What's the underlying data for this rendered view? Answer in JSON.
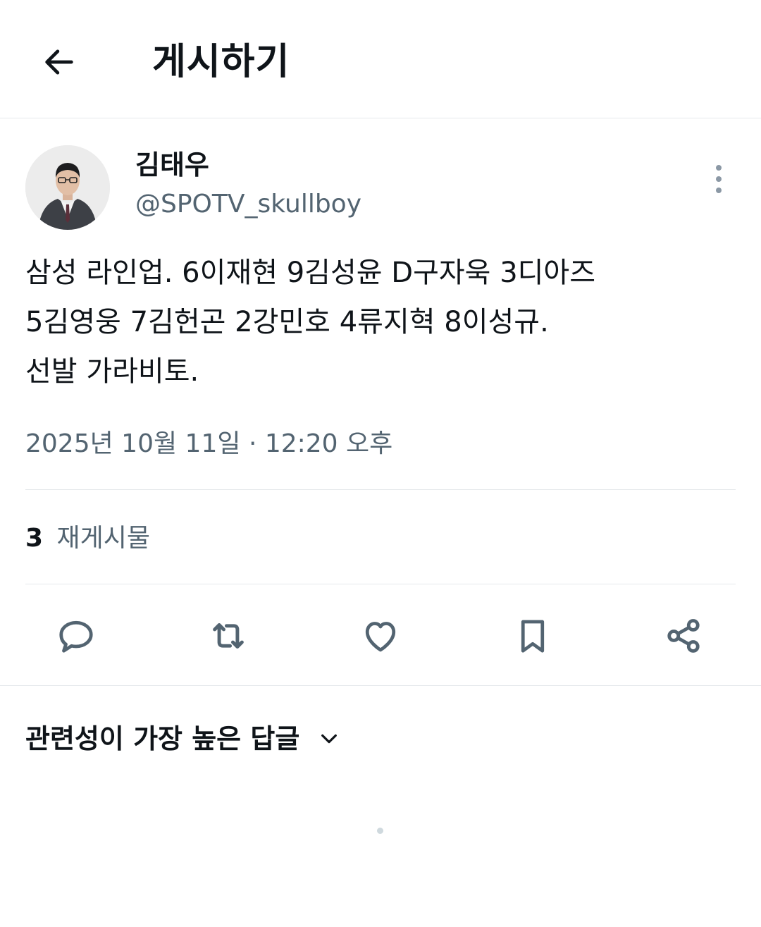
{
  "header": {
    "back_icon": "arrow-left-icon",
    "title": "게시하기"
  },
  "author": {
    "name": "김태우",
    "handle": "@SPOTV_skullboy",
    "avatar": "avatar-photo",
    "more_icon": "more-vertical-icon"
  },
  "post": {
    "lines": [
      "삼성 라인업. 6이재현 9김성윤 D구자욱 3디아즈",
      "5김영웅 7김헌곤 2강민호 4류지혁 8이성규.",
      "선발 가라비토."
    ],
    "date": "2025년 10월 11일",
    "separator": "·",
    "time": "12:20 오후"
  },
  "stats": {
    "reposts_count": "3",
    "reposts_label": "재게시물"
  },
  "actions": [
    {
      "name": "reply",
      "icon": "comment-icon"
    },
    {
      "name": "repost",
      "icon": "repost-icon"
    },
    {
      "name": "like",
      "icon": "heart-icon"
    },
    {
      "name": "bookmark",
      "icon": "bookmark-icon"
    },
    {
      "name": "share",
      "icon": "share-icon"
    }
  ],
  "replies": {
    "sort_label": "관련성이 가장 높은 답글",
    "sort_icon": "chevron-down-icon"
  },
  "colors": {
    "text_primary": "#0f1419",
    "text_secondary": "#536471",
    "divider": "#e6e9ec",
    "icon": "#536471"
  }
}
